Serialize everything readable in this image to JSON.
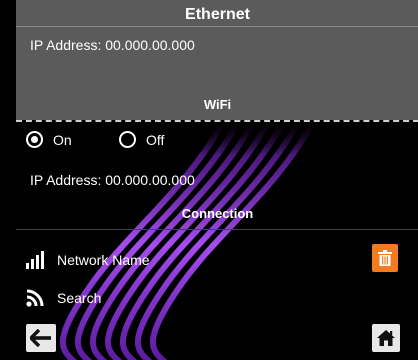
{
  "ethernet": {
    "title": "Ethernet",
    "ip_address": "IP Address: 00.000.00.000"
  },
  "wifi": {
    "title": "WiFi",
    "radio_on_label": "On",
    "radio_off_label": "Off",
    "selected": "On",
    "ip_address": "IP Address: 00.000.00.000"
  },
  "connection": {
    "title": "Connection",
    "network_name": "Network Name",
    "search": "Search"
  },
  "icons": {
    "signal": "signal-bars-icon",
    "wifi_search": "wifi-icon",
    "delete": "trash-icon",
    "back": "arrow-left-icon",
    "home": "home-icon"
  },
  "colors": {
    "ethernet_panel": "#5b5b5b",
    "background": "#000000",
    "accent_orange": "#f47b1f",
    "wave_purple": "#8a2fd6"
  }
}
